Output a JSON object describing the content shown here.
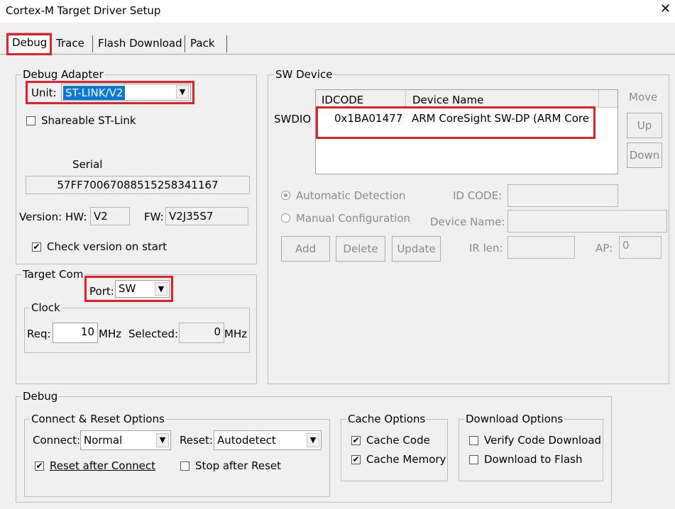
{
  "window": {
    "title": "Cortex-M Target Driver Setup",
    "close_glyph": "✕"
  },
  "tabs": [
    {
      "label": "Debug"
    },
    {
      "label": "Trace"
    },
    {
      "label": "Flash Download"
    },
    {
      "label": "Pack"
    }
  ],
  "debug_adapter": {
    "legend": "Debug Adapter",
    "unit_label": "Unit:",
    "unit_value": "ST-LINK/V2",
    "shareable_label": "Shareable ST-Link",
    "serial_label": "Serial",
    "serial_value": "57FF70067088515258341167",
    "version_label": "Version: HW:",
    "hw_value": "V2",
    "fw_label": "FW:",
    "fw_value": "V2J35S7",
    "check_version_label": "Check version on start",
    "check_mark": "✔"
  },
  "target_com": {
    "legend": "Target Com",
    "port_label": "Port:",
    "port_value": "SW",
    "clock_legend": "Clock",
    "req_label": "Req:",
    "req_value": "10",
    "req_unit": "MHz",
    "selected_label": "Selected:",
    "selected_value": "0",
    "selected_unit": "MHz"
  },
  "sw_device": {
    "legend": "SW Device",
    "col_idcode": "IDCODE",
    "col_device_name": "Device Name",
    "row_label": "SWDIO",
    "row_idcode": "0x1BA01477",
    "row_device_name": "ARM CoreSight SW-DP (ARM Core",
    "move_label": "Move",
    "up_label": "Up",
    "down_label": "Down",
    "auto_detect_label": "Automatic Detection",
    "manual_config_label": "Manual Configuration",
    "id_code_label": "ID CODE:",
    "device_name_label": "Device Name:",
    "add_label": "Add",
    "delete_label": "Delete",
    "update_label": "Update",
    "ir_len_label": "IR len:",
    "ap_label": "AP:",
    "ap_value": "0"
  },
  "debug": {
    "legend": "Debug",
    "connect_reset_legend": "Connect & Reset Options",
    "connect_label": "Connect:",
    "connect_value": "Normal",
    "reset_label": "Reset:",
    "reset_value": "Autodetect",
    "reset_after_connect_label": "Reset after Connect",
    "stop_after_reset_label": "Stop after Reset",
    "cache_legend": "Cache Options",
    "cache_code_label": "Cache Code",
    "cache_memory_label": "Cache Memory",
    "download_legend": "Download Options",
    "verify_label": "Verify Code Download",
    "download_flash_label": "Download to Flash"
  },
  "icons": {
    "dropdown": "▼"
  },
  "colors": {
    "highlight_border": "#e5202a",
    "selection_bg": "#0a78d7"
  }
}
